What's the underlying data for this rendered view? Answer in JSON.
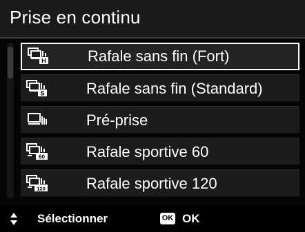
{
  "header": {
    "title": "Prise en continu"
  },
  "menu": {
    "items": [
      {
        "label": "Rafale sans fin (Fort)",
        "icon": "burst-h-icon",
        "badge": "H",
        "selected": true
      },
      {
        "label": "Rafale sans fin (Standard)",
        "icon": "burst-s-icon",
        "badge": "S",
        "selected": false
      },
      {
        "label": "Pré-prise",
        "icon": "pre-capture-icon",
        "badge": "",
        "selected": false
      },
      {
        "label": "Rafale sportive 60",
        "icon": "sport-burst-60-icon",
        "badge": "60",
        "selected": false
      },
      {
        "label": "Rafale sportive 120",
        "icon": "sport-burst-120-icon",
        "badge": "120",
        "selected": false
      }
    ]
  },
  "footer": {
    "select_label": "Sélectionner",
    "ok_badge": "OK",
    "ok_label": "OK"
  },
  "colors": {
    "background": "#050505",
    "item_background": "#1c1c1c",
    "selected_border": "#ffffff",
    "text": "#ffffff"
  }
}
